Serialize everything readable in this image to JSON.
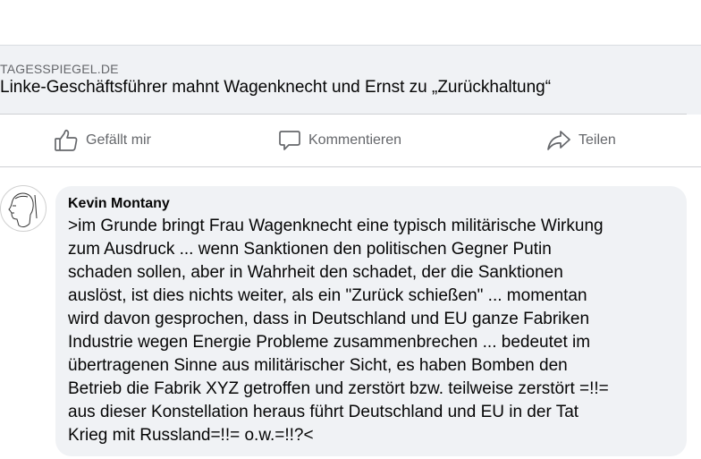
{
  "link_preview": {
    "domain": "TAGESSPIEGEL.DE",
    "title": "Linke-Geschäftsführer mahnt Wagenknecht und Ernst zu „Zurückhaltung“"
  },
  "actions": {
    "like_label": "Gefällt mir",
    "comment_label": "Kommentieren",
    "share_label": "Teilen"
  },
  "comment": {
    "author": "Kevin Montany",
    "text": ">im Grunde bringt Frau Wagenknecht eine typisch militärische Wirkung\nzum Ausdruck ... wenn Sanktionen den politischen Gegner Putin\nschaden sollen, aber in Wahrheit den schadet, der die Sanktionen\nauslöst, ist dies nichts weiter, als ein \"Zurück schießen\" ... momentan\nwird davon gesprochen, dass in Deutschland und EU ganze Fabriken\nIndustrie wegen Energie Probleme  zusammenbrechen ... bedeutet im\nübertragenen Sinne aus militärischer Sicht, es haben Bomben den\nBetrieb die Fabrik XYZ getroffen und zerstört bzw. teilweise zerstört  =!!=\naus dieser Konstellation heraus führt Deutschland und EU in der Tat\nKrieg mit Russland=!!= o.w.=!!?<"
  },
  "icons": {
    "like": "thumbs-up-icon",
    "comment": "speech-bubble-icon",
    "share": "share-arrow-icon",
    "avatar": "sketch-portrait"
  },
  "colors": {
    "secondary_text": "#65676b",
    "bubble_bg": "#f0f2f5",
    "divider": "#ced0d4"
  }
}
